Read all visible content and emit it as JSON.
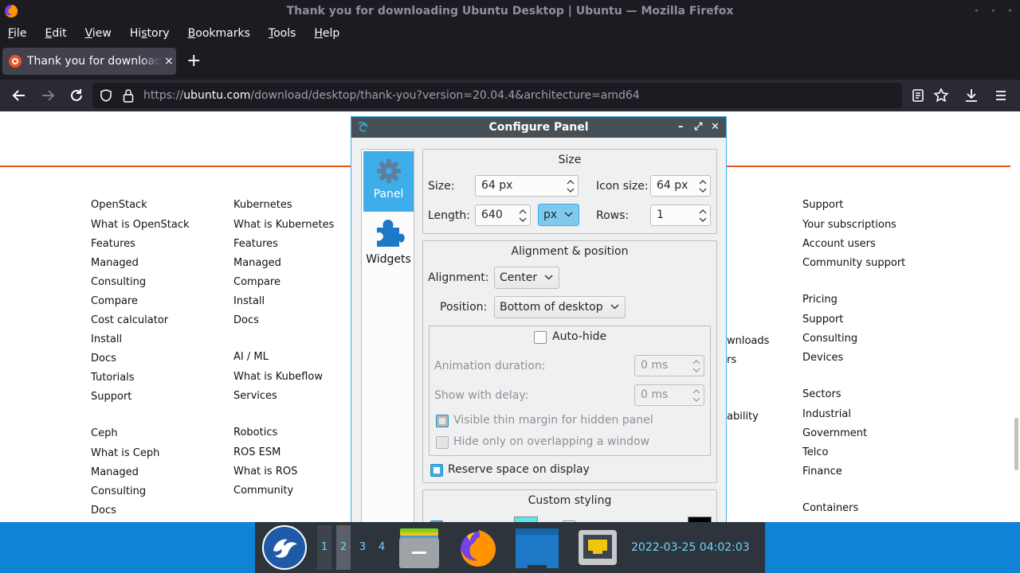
{
  "window": {
    "title": "Thank you for downloading Ubuntu Desktop | Ubuntu — Mozilla Firefox"
  },
  "menu": [
    "File",
    "Edit",
    "View",
    "History",
    "Bookmarks",
    "Tools",
    "Help"
  ],
  "menu_mnemonics": [
    "F",
    "E",
    "V",
    "s",
    "B",
    "T",
    "H"
  ],
  "tab": {
    "title": "Thank you for downloading Ubuntu Desktop",
    "close": "×"
  },
  "newtab": "+",
  "nav": {
    "url_prefix": "https://",
    "url_domain": "ubuntu.com",
    "url_path": "/download/desktop/thank-you?version=20.04.4&architecture=amd64"
  },
  "page": {
    "columns": [
      {
        "sections": [
          {
            "heading": "OpenStack",
            "links": [
              "What is OpenStack",
              "Features",
              "Managed",
              "Consulting",
              "Compare",
              "Cost calculator",
              "Install",
              "Docs",
              "Tutorials",
              "Support"
            ]
          },
          {
            "heading": "Ceph",
            "links": [
              "What is Ceph",
              "Managed",
              "Consulting",
              "Docs"
            ]
          }
        ]
      },
      {
        "sections": [
          {
            "heading": "Kubernetes",
            "links": [
              "What is Kubernetes",
              "Features",
              "Managed",
              "Compare",
              "Install",
              "Docs"
            ]
          },
          {
            "heading": "AI / ML",
            "links": [
              "What is Kubeflow",
              "Services"
            ]
          },
          {
            "heading": "Robotics",
            "links": [
              "ROS ESM",
              "What is ROS",
              "Community"
            ]
          }
        ]
      },
      {
        "sections": [
          {
            "heading": "Support",
            "links": [
              "Your subscriptions",
              "Account users",
              "Community support"
            ]
          },
          {
            "heading": "Pricing",
            "links": [
              "Support",
              "Consulting",
              "Devices"
            ]
          },
          {
            "heading": "Sectors",
            "links": [
              "Industrial",
              "Government",
              "Telco",
              "Finance"
            ]
          },
          {
            "heading": "",
            "links": [
              "Containers"
            ]
          }
        ]
      }
    ],
    "fragments": [
      "wnloads",
      "rs",
      "ability"
    ]
  },
  "dialog": {
    "title": "Configure Panel",
    "controls": [
      "–",
      "⤢",
      "✕"
    ],
    "sidebar": [
      "Panel",
      "Widgets"
    ],
    "size_group": {
      "title": "Size",
      "size_label": "Size:",
      "size_value": "64 px",
      "icon_size_label": "Icon size:",
      "icon_size_value": "64 px",
      "length_label": "Length:",
      "length_value": "640",
      "length_unit": "px",
      "rows_label": "Rows:",
      "rows_value": "1"
    },
    "align_group": {
      "title": "Alignment & position",
      "alignment_label": "Alignment:",
      "alignment_value": "Center",
      "position_label": "Position:",
      "position_value": "Bottom of desktop",
      "autohide_label": "Auto-hide",
      "autohide_checked": false,
      "anim_label": "Animation duration:",
      "anim_value": "0 ms",
      "delay_label": "Show with delay:",
      "delay_value": "0 ms",
      "thin_margin_label": "Visible thin margin for hidden panel",
      "thin_margin_checked": true,
      "overlap_label": "Hide only on overlapping a window",
      "overlap_checked": false,
      "reserve_label": "Reserve space on display",
      "reserve_checked": true
    },
    "styling_group": {
      "title": "Custom styling"
    }
  },
  "taskbar": {
    "desktops": [
      "1",
      "2",
      "3",
      "4"
    ],
    "current_desktop": "2",
    "clock": "2022-03-25 04:02:03 PM"
  },
  "colors": {
    "firefox_dark": "#1c1b22",
    "firefox_nav": "#2b2a33",
    "ubuntu_orange": "#e95420",
    "kde_accent": "#3daee9",
    "desktop_blue": "#0f84d6",
    "panel_dark": "#2d343b",
    "clock_text": "#6cd5ff"
  }
}
